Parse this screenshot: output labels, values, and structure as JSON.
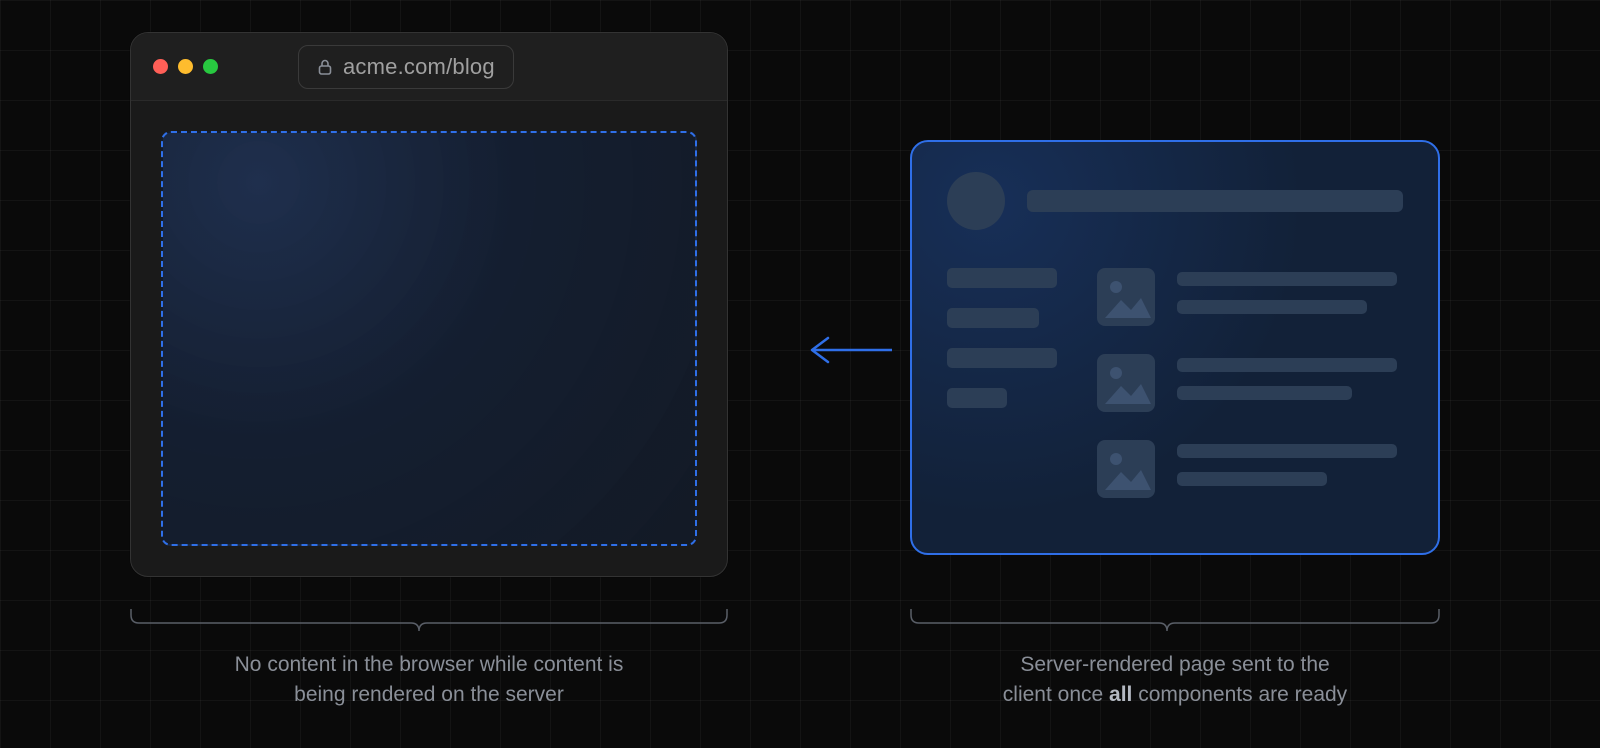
{
  "browser": {
    "url": "acme.com/blog",
    "traffic_lights": [
      "red",
      "yellow",
      "green"
    ]
  },
  "arrow_direction": "left",
  "captions": {
    "left_line1": "No content in the browser while content is",
    "left_line2": "being rendered on the server",
    "right_prefix": "Server-rendered page sent to the",
    "right_line2_before": "client once ",
    "right_bold": "all",
    "right_line2_after": " components are ready"
  },
  "server_card": {
    "sidebar_item_widths": [
      110,
      92,
      110,
      60
    ],
    "posts": [
      {
        "line_widths": [
          220,
          190
        ]
      },
      {
        "line_widths": [
          220,
          175
        ]
      },
      {
        "line_widths": [
          220,
          150
        ]
      }
    ]
  },
  "colors": {
    "accent": "#2f6fe8",
    "placeholder": "#2c3e56",
    "card_bg": "#122138"
  }
}
